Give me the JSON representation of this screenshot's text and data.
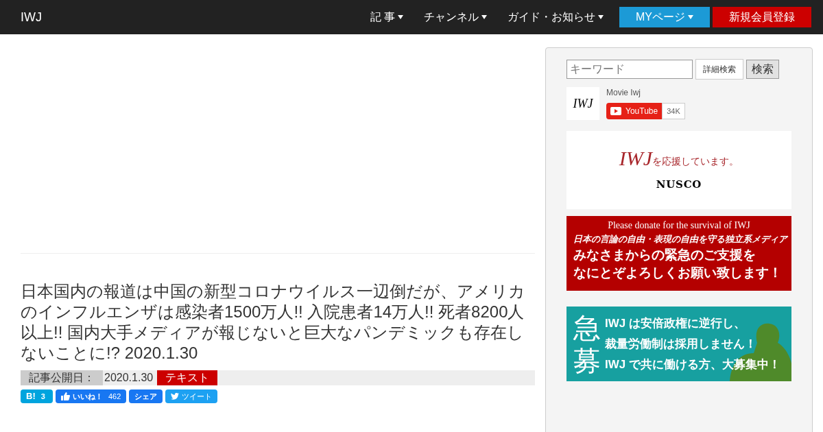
{
  "navbar": {
    "brand": "IWJ",
    "menu": [
      {
        "label": "記 事",
        "kind": "dropdown"
      },
      {
        "label": "チャンネル",
        "kind": "dropdown"
      },
      {
        "label": "ガイド・お知らせ",
        "kind": "dropdown"
      },
      {
        "label": "MYページ",
        "kind": "mypage"
      },
      {
        "label": "新規会員登録",
        "kind": "register"
      }
    ]
  },
  "article": {
    "title": "日本国内の報道は中国の新型コロナウイルス一辺倒だが、アメリカのインフルエンザは感染者1500万人!! 入院患者14万人!! 死者8200人以上!! 国内大手メディアが報じないと巨大なパンデミックも存在しないことに!? 2020.1.30",
    "date_label": "記事公開日：",
    "date": "2020.1.30",
    "tag": "テキスト",
    "share": [
      {
        "kind": "hatena",
        "label": "B!",
        "count": "3"
      },
      {
        "kind": "like",
        "label": "いいね！",
        "count": "462"
      },
      {
        "kind": "share",
        "label": "シェア"
      },
      {
        "kind": "tweet",
        "label": "ツイート"
      }
    ]
  },
  "sidebar": {
    "search": {
      "placeholder": "キーワード",
      "advanced": "詳細検索",
      "submit": "検索"
    },
    "channel": {
      "logo": "IWJ",
      "name": "Movie Iwj",
      "youtube": "YouTube",
      "count": "34K"
    },
    "banners": [
      {
        "kind": "sponsor",
        "logo": "IWJ",
        "text": "を応援しています。",
        "sponsor": "NUSCO"
      },
      {
        "kind": "donate",
        "lines": [
          "Please donate for the survival of IWJ",
          "日本の言論の自由・表現の自由を守る独立系メディア",
          "みなさまからの緊急のご支援を",
          "なにとぞよろしくお願い致します！"
        ]
      },
      {
        "kind": "recruit",
        "big": [
          "急",
          "募"
        ],
        "lines": [
          "IWJ は安倍政権に逆行し、",
          "裁量労働制は採用しません！",
          "IWJ で共に働ける方、大募集中！"
        ]
      }
    ]
  }
}
